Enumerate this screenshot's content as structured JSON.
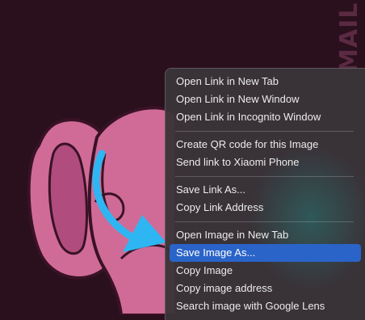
{
  "background": {
    "watermark_text": "MAIL",
    "colors": {
      "backdrop": "#2a0f1d",
      "character_fill": "#d06b98",
      "character_outline": "#3a1226",
      "arrow": "#2eb6f2"
    },
    "icons": [
      "cartoon-ear-character",
      "curved-arrow-icon"
    ]
  },
  "context_menu": {
    "groups": [
      {
        "items": [
          {
            "label": "Open Link in New Tab"
          },
          {
            "label": "Open Link in New Window"
          },
          {
            "label": "Open Link in Incognito Window"
          }
        ]
      },
      {
        "items": [
          {
            "label": "Create QR code for this Image"
          },
          {
            "label": "Send link to Xiaomi Phone"
          }
        ]
      },
      {
        "items": [
          {
            "label": "Save Link As..."
          },
          {
            "label": "Copy Link Address"
          }
        ]
      },
      {
        "items": [
          {
            "label": "Open Image in New Tab"
          },
          {
            "label": "Save Image As...",
            "highlighted": true
          },
          {
            "label": "Copy Image"
          },
          {
            "label": "Copy image address"
          },
          {
            "label": "Search image with Google Lens"
          }
        ]
      }
    ],
    "colors": {
      "highlight": "#2a64c8",
      "text": "#ececec"
    }
  }
}
